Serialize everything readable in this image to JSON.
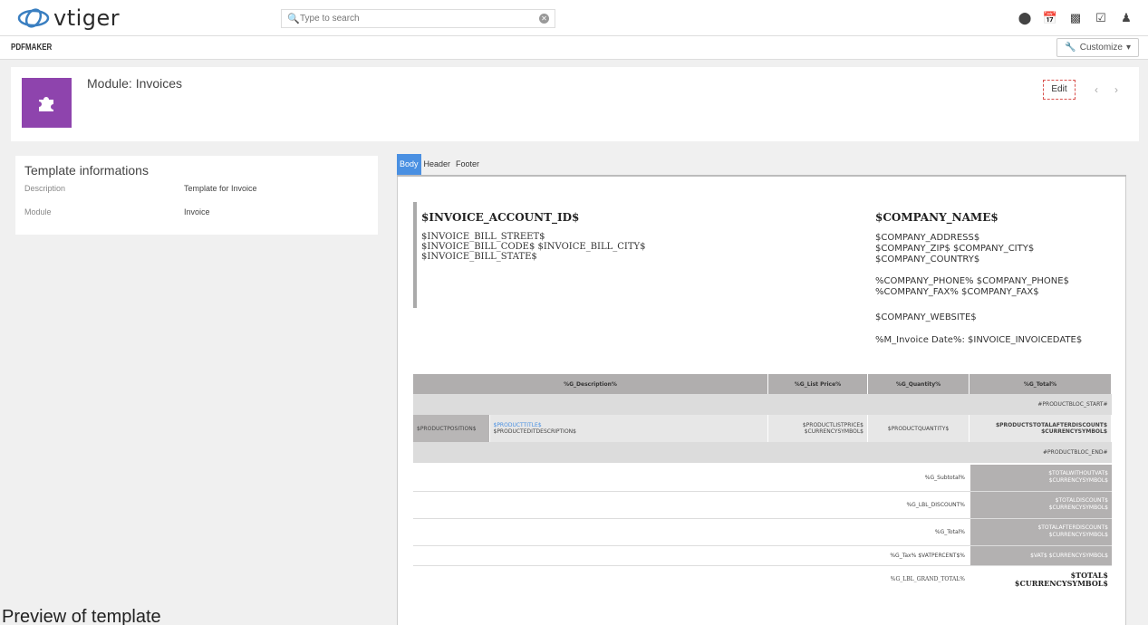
{
  "app": {
    "logo_text": "vtiger",
    "search_placeholder": "Type to search"
  },
  "topbar_icons": [
    "plus-circle-icon",
    "calendar-icon",
    "chart-icon",
    "tasks-icon",
    "user-icon"
  ],
  "subheader": {
    "brand": "PDFMAKER",
    "customize_label": "Customize"
  },
  "module": {
    "title": "Module: Invoices",
    "edit_label": "Edit"
  },
  "template_info": {
    "title": "Template informations",
    "rows": [
      {
        "label": "Description",
        "value": "Template for Invoice"
      },
      {
        "label": "Module",
        "value": "Invoice"
      }
    ]
  },
  "tabs": [
    "Body",
    "Header",
    "Footer"
  ],
  "active_tab": "Body",
  "preview_caption": "Preview of template",
  "doc": {
    "account_title": "$INVOICE_ACCOUNT_ID$",
    "account_lines": [
      "$INVOICE_BILL_STREET$",
      "$INVOICE_BILL_CODE$ $INVOICE_BILL_CITY$",
      "$INVOICE_BILL_STATE$"
    ],
    "company_title": "$COMPANY_NAME$",
    "company_address": [
      "$COMPANY_ADDRESS$",
      "$COMPANY_ZIP$ $COMPANY_CITY$",
      "$COMPANY_COUNTRY$"
    ],
    "company_phone": [
      "%COMPANY_PHONE% $COMPANY_PHONE$",
      "%COMPANY_FAX% $COMPANY_FAX$"
    ],
    "company_website": "$COMPANY_WEBSITE$",
    "invoice_date": "%M_Invoice Date%: $INVOICE_INVOICEDATE$",
    "table_headers": [
      "%G_Description%",
      "%G_List Price%",
      "%G_Quantity%",
      "%G_Total%"
    ],
    "bloc_start": "#PRODUCTBLOC_START#",
    "bloc_end": "#PRODUCTBLOC_END#",
    "product": {
      "position": "$PRODUCTPOSITION$",
      "title": "$PRODUCTTITLE$",
      "description": "$PRODUCTEDITDESCRIPTION$",
      "list_price": "$PRODUCTLISTPRICE$",
      "list_price_currency": "$CURRENCYSYMBOL$",
      "quantity": "$PRODUCTQUANTITY$",
      "total": "$PRODUCTSTOTALAFTERDISCOUNT$",
      "total_currency": "$CURRENCYSYMBOL$"
    },
    "totals": [
      {
        "label": "%G_Subtotal%",
        "value": "$TOTALWITHOUTVAT$",
        "currency": "$CURRENCYSYMBOL$"
      },
      {
        "label": "%G_LBL_DISCOUNT%",
        "value": "$TOTALDISCOUNT$",
        "currency": "$CURRENCYSYMBOL$"
      },
      {
        "label": "%G_Total%",
        "value": "$TOTALAFTERDISCOUNT$",
        "currency": "$CURRENCYSYMBOL$"
      },
      {
        "label": "%G_Tax% $VATPERCENT$%",
        "value": "$VAT$ $CURRENCYSYMBOL$",
        "currency": ""
      },
      {
        "label": "%G_LBL_GRAND_TOTAL%",
        "value": "$TOTAL$",
        "currency": "$CURRENCYSYMBOL$"
      }
    ]
  }
}
